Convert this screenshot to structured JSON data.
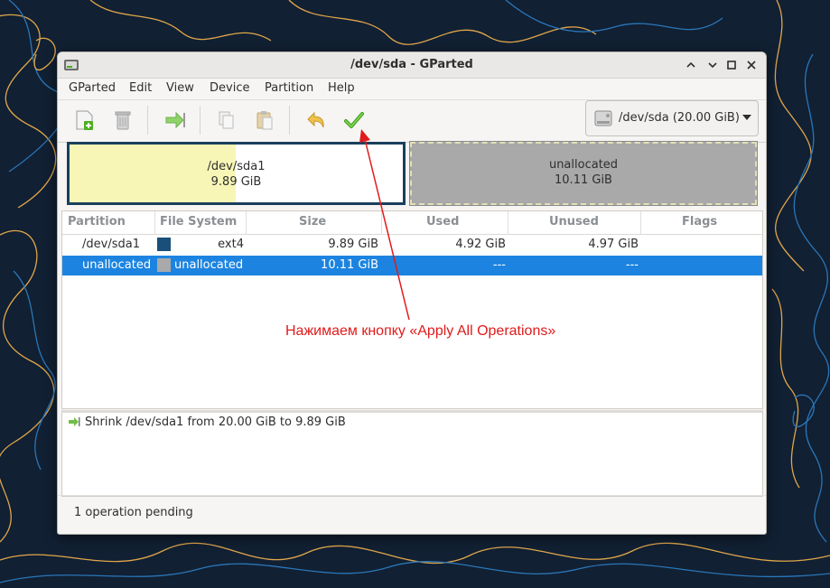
{
  "window": {
    "title": "/dev/sda - GParted"
  },
  "menubar": {
    "items": [
      "GParted",
      "Edit",
      "View",
      "Device",
      "Partition",
      "Help"
    ]
  },
  "toolbar": {
    "buttons": [
      {
        "icon": "new-partition-icon"
      },
      {
        "icon": "delete-icon"
      },
      {
        "icon": "resize-move-icon"
      },
      {
        "icon": "copy-icon"
      },
      {
        "icon": "paste-icon"
      },
      {
        "icon": "undo-icon"
      },
      {
        "icon": "apply-icon"
      }
    ],
    "device_selector": "/dev/sda (20.00 GiB)"
  },
  "disk_map": {
    "partitions": [
      {
        "name": "/dev/sda1",
        "size": "9.89 GiB",
        "used_fraction": 0.497,
        "color": "#1a3f5c"
      },
      {
        "name": "unallocated",
        "size": "10.11 GiB",
        "color": "#a9a9a9"
      }
    ]
  },
  "table": {
    "columns": [
      "Partition",
      "File System",
      "Size",
      "Used",
      "Unused",
      "Flags"
    ],
    "rows": [
      {
        "partition": "/dev/sda1",
        "fs": "ext4",
        "fs_color": "#1a4f7a",
        "size": "9.89 GiB",
        "used": "4.92 GiB",
        "unused": "4.97 GiB",
        "flags": ""
      },
      {
        "partition": "unallocated",
        "fs": "unallocated",
        "fs_color": "#a9a9a9",
        "size": "10.11 GiB",
        "used": "---",
        "unused": "---",
        "flags": "",
        "selected": true
      }
    ]
  },
  "operations": [
    {
      "text": "Shrink /dev/sda1 from 20.00 GiB to 9.89 GiB",
      "icon": "resize-icon"
    }
  ],
  "status": {
    "text": "1 operation pending"
  },
  "annotation": {
    "text": "Нажимаем кнопку «Apply All Operations»",
    "color": "#e01b1b"
  },
  "colors": {
    "selection": "#1c84e0",
    "accent_apply": "#4caf1f"
  }
}
